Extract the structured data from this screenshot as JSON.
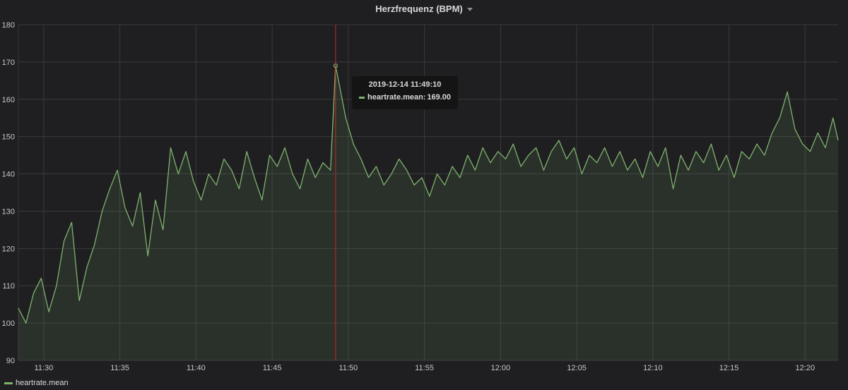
{
  "panel": {
    "title": "Herzfrequenz (BPM)"
  },
  "colors": {
    "series": "#7eb26d",
    "hover_line": "#c62828",
    "grid": "#3a3a3c",
    "background": "#1f1f21"
  },
  "tooltip": {
    "time": "2019-12-14 11:49:10",
    "series_label": "heartrate.mean:",
    "value": "169.00"
  },
  "legend": {
    "items": [
      "heartrate.mean"
    ]
  },
  "chart_data": {
    "type": "area",
    "title": "Herzfrequenz (BPM)",
    "xlabel": "",
    "ylabel": "",
    "ylim": [
      90,
      180
    ],
    "xlim": [
      "11:28:20",
      "12:22:10"
    ],
    "y_ticks": [
      90,
      100,
      110,
      120,
      130,
      140,
      150,
      160,
      170,
      180
    ],
    "x_ticks": [
      "11:30",
      "11:35",
      "11:40",
      "11:45",
      "11:50",
      "11:55",
      "12:00",
      "12:05",
      "12:10",
      "12:15",
      "12:20"
    ],
    "grid": true,
    "legend_position": "bottom-left",
    "hover": {
      "time": "11:49:10",
      "value": 169.0
    },
    "series": [
      {
        "name": "heartrate.mean",
        "x": [
          "11:28:20",
          "11:28:50",
          "11:29:20",
          "11:29:50",
          "11:30:20",
          "11:30:50",
          "11:31:20",
          "11:31:50",
          "11:32:20",
          "11:32:50",
          "11:33:20",
          "11:33:50",
          "11:34:20",
          "11:34:50",
          "11:35:20",
          "11:35:50",
          "11:36:20",
          "11:36:50",
          "11:37:20",
          "11:37:50",
          "11:38:20",
          "11:38:50",
          "11:39:20",
          "11:39:50",
          "11:40:20",
          "11:40:50",
          "11:41:20",
          "11:41:50",
          "11:42:20",
          "11:42:50",
          "11:43:20",
          "11:43:50",
          "11:44:20",
          "11:44:50",
          "11:45:20",
          "11:45:50",
          "11:46:20",
          "11:46:50",
          "11:47:20",
          "11:47:50",
          "11:48:20",
          "11:48:50",
          "11:49:10",
          "11:49:30",
          "11:49:50",
          "11:50:20",
          "11:50:50",
          "11:51:20",
          "11:51:50",
          "11:52:20",
          "11:52:50",
          "11:53:20",
          "11:53:50",
          "11:54:20",
          "11:54:50",
          "11:55:20",
          "11:55:50",
          "11:56:20",
          "11:56:50",
          "11:57:20",
          "11:57:50",
          "11:58:20",
          "11:58:50",
          "11:59:20",
          "11:59:50",
          "12:00:20",
          "12:00:50",
          "12:01:20",
          "12:01:50",
          "12:02:20",
          "12:02:50",
          "12:03:20",
          "12:03:50",
          "12:04:20",
          "12:04:50",
          "12:05:20",
          "12:05:50",
          "12:06:20",
          "12:06:50",
          "12:07:20",
          "12:07:50",
          "12:08:20",
          "12:08:50",
          "12:09:20",
          "12:09:50",
          "12:10:20",
          "12:10:50",
          "12:11:20",
          "12:11:50",
          "12:12:20",
          "12:12:50",
          "12:13:20",
          "12:13:50",
          "12:14:20",
          "12:14:50",
          "12:15:20",
          "12:15:50",
          "12:16:20",
          "12:16:50",
          "12:17:20",
          "12:17:50",
          "12:18:20",
          "12:18:50",
          "12:19:20",
          "12:19:50",
          "12:20:20",
          "12:20:50",
          "12:21:20",
          "12:21:50",
          "12:22:10"
        ],
        "values": [
          104,
          100,
          108,
          112,
          103,
          110,
          122,
          127,
          106,
          115,
          121,
          130,
          136,
          141,
          131,
          126,
          135,
          118,
          133,
          125,
          147,
          140,
          146,
          138,
          133,
          140,
          137,
          144,
          141,
          136,
          146,
          139,
          133,
          145,
          142,
          147,
          140,
          136,
          144,
          139,
          143,
          141,
          169,
          162,
          155,
          148,
          144,
          139,
          142,
          137,
          140,
          144,
          141,
          137,
          139,
          134,
          140,
          137,
          142,
          139,
          145,
          141,
          147,
          143,
          146,
          144,
          148,
          142,
          145,
          147,
          141,
          146,
          149,
          144,
          147,
          140,
          145,
          143,
          147,
          142,
          146,
          141,
          144,
          139,
          146,
          142,
          147,
          136,
          145,
          141,
          146,
          143,
          148,
          141,
          145,
          139,
          146,
          144,
          148,
          145,
          151,
          155,
          162,
          152,
          148,
          146,
          151,
          147,
          155,
          149
        ]
      }
    ]
  }
}
